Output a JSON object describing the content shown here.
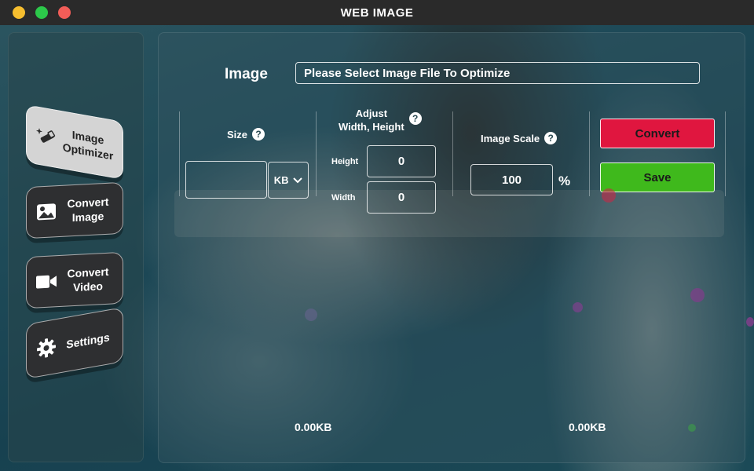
{
  "window": {
    "title": "WEB IMAGE"
  },
  "sidebar": {
    "items": [
      {
        "label_line1": "Image",
        "label_line2": "Optimizer",
        "icon": "magic-wand-icon",
        "active": true
      },
      {
        "label_line1": "Convert",
        "label_line2": "Image",
        "icon": "image-icon",
        "active": false
      },
      {
        "label_line1": "Convert",
        "label_line2": "Video",
        "icon": "video-camera-icon",
        "active": false
      },
      {
        "label_line1": "Settings",
        "label_line2": "",
        "icon": "gear-icon",
        "active": false
      }
    ]
  },
  "main": {
    "image_label": "Image",
    "image_placeholder": "Please Select Image File To Optimize",
    "size": {
      "label": "Size",
      "value": "",
      "unit": "KB",
      "help": "?"
    },
    "adjust": {
      "label_line1": "Adjust",
      "label_line2": "Width, Height",
      "help": "?",
      "height_label": "Height",
      "height_value": "0",
      "width_label": "Width",
      "width_value": "0"
    },
    "scale": {
      "label": "Image Scale",
      "value": "100",
      "unit": "%",
      "help": "?"
    },
    "convert_label": "Convert",
    "save_label": "Save",
    "original_size": "0.00KB",
    "optimized_size": "0.00KB"
  },
  "colors": {
    "convert": "#e0163f",
    "save": "#3fb91c",
    "titlebar": "#2a2a2a"
  }
}
